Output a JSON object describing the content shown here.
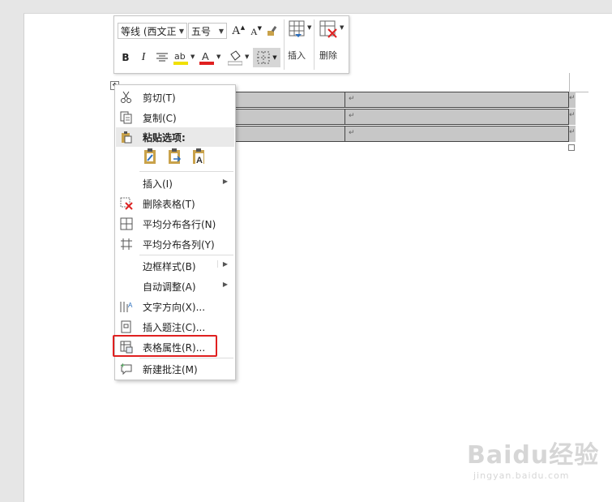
{
  "minibar": {
    "font_name": "等线 (西文正",
    "font_size": "五号",
    "grow_font": "A",
    "shrink_font": "A",
    "bold": "B",
    "italic": "I",
    "font_color_letter": "A",
    "insert_label": "插入",
    "delete_label": "删除"
  },
  "table": {
    "return_mark": "↵",
    "rows": 3
  },
  "context_menu": {
    "items": [
      {
        "label": "剪切(T)",
        "icon": "scissors-icon"
      },
      {
        "label": "复制(C)",
        "icon": "copy-icon"
      },
      {
        "label": "粘贴选项:",
        "icon": "paste-icon"
      },
      {
        "label": "插入(I)",
        "icon": "",
        "submenu": true
      },
      {
        "label": "删除表格(T)",
        "icon": "delete-table-icon"
      },
      {
        "label": "平均分布各行(N)",
        "icon": "distribute-rows-icon"
      },
      {
        "label": "平均分布各列(Y)",
        "icon": "distribute-columns-icon"
      },
      {
        "label": "边框样式(B)",
        "icon": "",
        "submenu": true
      },
      {
        "label": "自动调整(A)",
        "icon": "",
        "submenu": true
      },
      {
        "label": "文字方向(X)...",
        "icon": "text-direction-icon"
      },
      {
        "label": "插入题注(C)...",
        "icon": "insert-caption-icon"
      },
      {
        "label": "表格属性(R)...",
        "icon": "table-properties-icon"
      },
      {
        "label": "新建批注(M)",
        "icon": "new-comment-icon"
      }
    ],
    "submenu_arrow": "▶",
    "paste_options": [
      "keep-source-formatting-icon",
      "merge-formatting-icon",
      "keep-text-only-icon"
    ]
  },
  "watermark": {
    "brand": "Baidu经验",
    "url": "jingyan.baidu.com"
  },
  "colors": {
    "highlight_border": "#e02020",
    "cell_shading": "#c7c7c7",
    "font_color_bar": "#e02020",
    "highlight_bar": "#f0e000"
  }
}
